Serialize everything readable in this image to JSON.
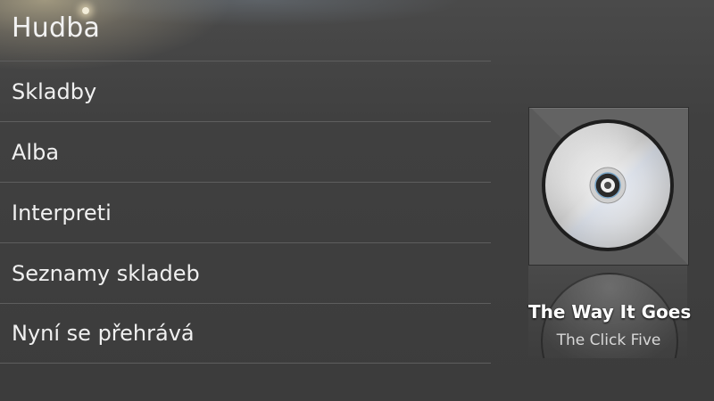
{
  "header": {
    "title": "Hudba"
  },
  "menu": {
    "items": [
      {
        "label": "Skladby"
      },
      {
        "label": "Alba"
      },
      {
        "label": "Interpreti"
      },
      {
        "label": "Seznamy skladeb"
      },
      {
        "label": "Nyní se přehrává"
      }
    ]
  },
  "now_playing": {
    "song_title": "The Way It Goes",
    "artist": "The Click Five",
    "album_art_icon": "cd-disc-icon"
  },
  "colors": {
    "background": "#3f3f3f",
    "divider": "#5e5e5e",
    "text_primary": "#f0f0f0",
    "text_secondary": "#d8d8d8"
  }
}
